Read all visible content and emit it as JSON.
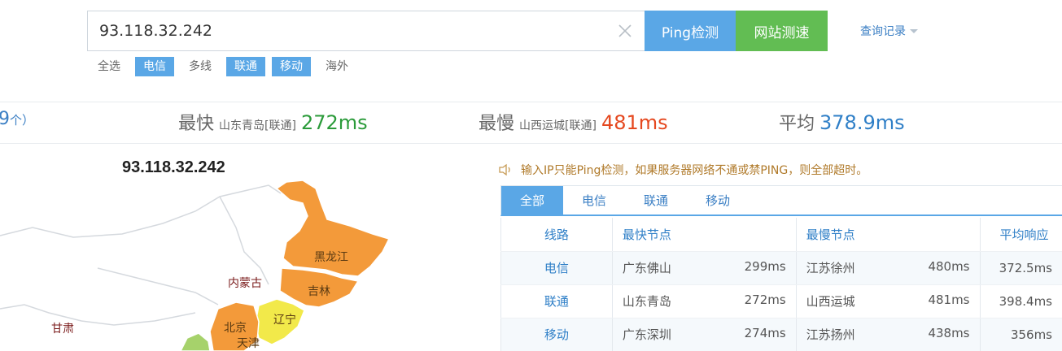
{
  "search": {
    "value": "93.118.32.242",
    "ping_button": "Ping检测",
    "speed_button": "网站测速",
    "history_label": "查询记录"
  },
  "filters": [
    {
      "label": "全选",
      "active": false
    },
    {
      "label": "电信",
      "active": true
    },
    {
      "label": "多线",
      "active": false
    },
    {
      "label": "联通",
      "active": true
    },
    {
      "label": "移动",
      "active": true
    },
    {
      "label": "海外",
      "active": false
    }
  ],
  "summary": {
    "count_num": "9",
    "count_unit": "个）",
    "fastest_label": "最快",
    "fastest_place": "山东青岛[联通]",
    "fastest_value": "272ms",
    "slowest_label": "最慢",
    "slowest_place": "山西运城[联通]",
    "slowest_value": "481ms",
    "average_label": "平均",
    "average_value": "378.9ms"
  },
  "map": {
    "title": "93.118.32.242",
    "provinces": [
      "黑龙江",
      "吉林",
      "内蒙古",
      "辽宁",
      "北京",
      "天津",
      "甘肃"
    ]
  },
  "notice": "输入IP只能Ping检测，如果服务器网络不通或禁PING，则全部超时。",
  "tabs": [
    "全部",
    "电信",
    "联通",
    "移动"
  ],
  "table": {
    "headers": [
      "线路",
      "最快节点",
      "最慢节点",
      "平均响应"
    ],
    "rows": [
      {
        "line": "电信",
        "fast_node": "广东佛山",
        "fast_ms": "299ms",
        "slow_node": "江苏徐州",
        "slow_ms": "480ms",
        "avg": "372.5ms"
      },
      {
        "line": "联通",
        "fast_node": "山东青岛",
        "fast_ms": "272ms",
        "slow_node": "山西运城",
        "slow_ms": "481ms",
        "avg": "398.4ms"
      },
      {
        "line": "移动",
        "fast_node": "广东深圳",
        "fast_ms": "274ms",
        "slow_node": "江苏扬州",
        "slow_ms": "438ms",
        "avg": "356ms"
      }
    ]
  },
  "colors": {
    "accent_blue": "#5aa7e6",
    "accent_green": "#62bd53",
    "map_orange": "#f39a3a",
    "map_yellow": "#f2e94a",
    "fast_green": "#2b9b3a",
    "slow_red": "#e5481f"
  }
}
